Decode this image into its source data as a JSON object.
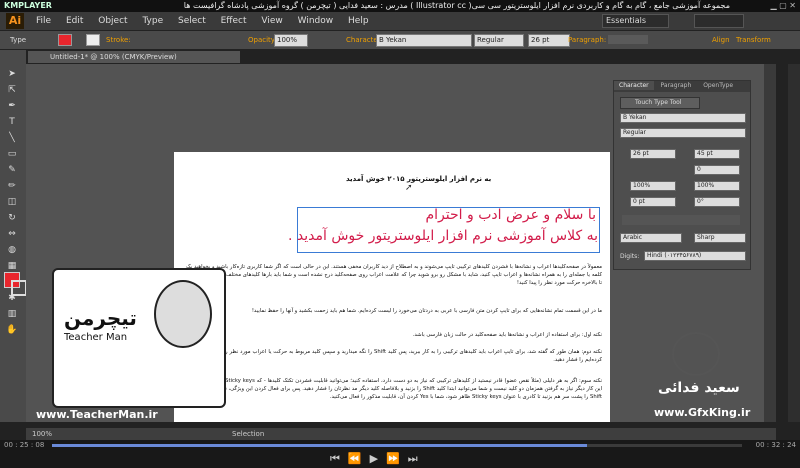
{
  "player": {
    "name": "KMPLAYER"
  },
  "window": {
    "title": "مجموعه آموزشی جامع ، گام به گام و کاربردی نرم افزار ایلوستریتور سی سی( Illustrator cc ) مدرس : سعید فدایی ( تیچرمن ) گروه آموزشی پادشاه گرافیست ها"
  },
  "app": {
    "logo": "Ai",
    "menu": [
      "File",
      "Edit",
      "Object",
      "Type",
      "Select",
      "Effect",
      "View",
      "Window",
      "Help"
    ],
    "workspace": "Essentials"
  },
  "control_bar": {
    "type_label": "Type",
    "stroke_label": "Stroke:",
    "opacity_label": "Opacity:",
    "opacity_value": "100%",
    "character_label": "Character:",
    "font_value": "B Yekan",
    "style_value": "Regular",
    "size_value": "26 pt",
    "paragraph_label": "Paragraph:",
    "align_label": "Align",
    "transform_label": "Transform"
  },
  "document": {
    "tab": "Untitled-1* @ 100% (CMYK/Preview)"
  },
  "artboard": {
    "heading": "به نرم افزار ایلوستریتور ۲۰۱۵ خوش آمدید",
    "greeting_line1": "با سلام و عرض ادب و احترام",
    "greeting_line2": "به کلاس آموزشی نرم افزار ایلوستریتور خوش آمدید .",
    "paragraphs": [
      "معمولاً در صفحه‌کلیدها اعراب و نشانه‌ها با فشردن کلیدهای ترکیبی تایپ می‌شوند و به اصطلاح از دید کاربران مخفی هستند. این در حالی است که اگر شما کاربری تازه‌کار باشید و بخواهید یک کلمه یا جمله‌ای را به همراه نشانه‌ها و اعراب تایپ کنید، شاید با مشکل رو برو شوید چرا که علامت اعراب روی صفحه‌کلید درج نشده است و شما باید بارها کلیدهای مختلف را امتحان می‌کنید تا بالاخره حرکت مورد نظر را پیدا کنید!",
      "ما در این قسمت تمام نشانه‌هایی که برای تایپ کردن متن فارسی با عربی به دردتان می‌خورد را لیست کرده‌ایم. شما هم باید زحمت بکشید و آنها را حفظ نمایید!",
      "نکته اول: برای استفاده از اعراب و نشانه‌ها باید صفحه‌کلید در حالت زبان فارسی باشد.",
      "نکته دوم: همان طور که گفته شد، برای تایپ اعراب باید کلیدهای ترکیبی را به کار ببرید، پس کلید Shift را نگه میدارید و سپس کلید مربوط به حرکت یا اعراب مورد نظر را که در زیر عنوان کرده‌ایم را فشار دهید.",
      "نکته سوم: اگر به هر دلیلی (مثلاً نقص عضو) قادر نیستید از کلیدهای ترکیبی که نیاز به دو دست دارد، استفاده کنید؛ می‌توانید قابلیت فشردن تکتک کلیدها - که Sticky keys - را فعال کنید. با این کار دیگر نیاز به گرفتن همزمان دو کلید نیست و شما می‌توانید ابتدا کلید Shift را بزنید و بلافاصله کلید دیگر مد نظرتان را فشار دهید. پس برای فعال کردن این ویژگی، ۵ بار (پنج بار) کلید Shift را پشت سر هم بزنید تا کادری با عنوان Sticky keys ظاهر شود، شما با Yes کردن آن، قابلیت مذکور را فعال می‌کنید."
    ]
  },
  "character_panel": {
    "tabs": [
      "Character",
      "Paragraph",
      "OpenType"
    ],
    "touch_tool": "Touch Type Tool",
    "font": "B Yekan",
    "style": "Regular",
    "size": "26 pt",
    "leading": "45 pt",
    "tracking": "0",
    "scale_v": "100%",
    "scale_h": "100%",
    "baseline": "0 pt",
    "rotation": "0°",
    "language": "Arabic",
    "aa": "Sharp",
    "digits_label": "Digits:",
    "digits_value": "Hindi (۰۱۲۳۴۵۶۷۸۹)"
  },
  "status": {
    "zoom": "100%",
    "mode": "Selection"
  },
  "player_bar": {
    "elapsed": "00 : 25 : 08",
    "total": "00 : 32 : 24"
  },
  "watermark": {
    "left_brand_fa": "تیچرمن",
    "left_brand_en": "Teacher Man",
    "left_url": "www.TeacherMan.ir",
    "right_name": "سعید فدائی",
    "right_url": "www.GfxKing.ir"
  },
  "colors": {
    "accent": "#f7931e",
    "fill": "#e8262d",
    "greeting_text": "#d21c4a",
    "selection": "#3a7bd5"
  }
}
